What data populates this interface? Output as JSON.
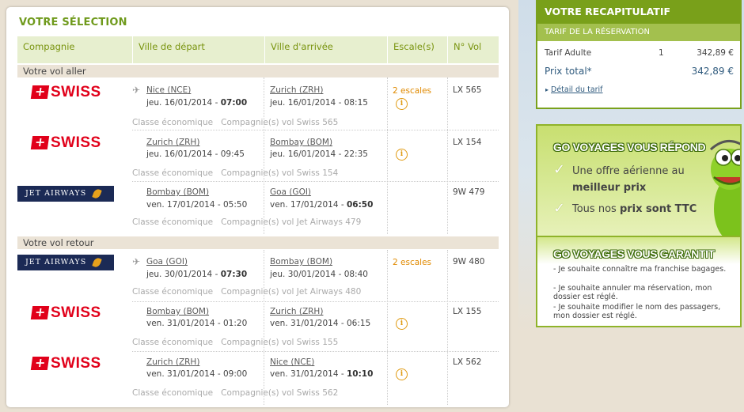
{
  "selection": {
    "title": "VOTRE SÉLECTION",
    "headers": [
      "Compagnie",
      "Ville de départ",
      "Ville d'arrivée",
      "Escale(s)",
      "N° Vol"
    ],
    "outbound_label": "Votre vol aller",
    "return_label": "Votre vol retour",
    "flights": [
      {
        "airline": "SWISS",
        "dep_city": "Nice (NCE)",
        "dep_date": "jeu. 16/01/2014 - ",
        "dep_time": "07:00",
        "arr_city": "Zurich (ZRH)",
        "arr_date": "jeu. 16/01/2014 - 08:15",
        "arr_time": "",
        "stops": "2 escales",
        "flight_no": "LX 565",
        "class": "Classe économique",
        "operated": "Compagnie(s) vol Swiss 565"
      },
      {
        "airline": "SWISS",
        "dep_city": "Zurich (ZRH)",
        "dep_date": "jeu. 16/01/2014 - 09:45",
        "dep_time": "",
        "arr_city": "Bombay (BOM)",
        "arr_date": "jeu. 16/01/2014 - 22:35",
        "arr_time": "",
        "stops": "",
        "flight_no": "LX 154",
        "class": "Classe économique",
        "operated": "Compagnie(s) vol Swiss 154"
      },
      {
        "airline": "JET AIRWAYS",
        "dep_city": "Bombay (BOM)",
        "dep_date": "ven. 17/01/2014 - 05:50",
        "dep_time": "",
        "arr_city": "Goa (GOI)",
        "arr_date": "ven. 17/01/2014 - ",
        "arr_time": "06:50",
        "stops": "",
        "flight_no": "9W 479",
        "class": "Classe économique",
        "operated": "Compagnie(s) vol Jet Airways 479"
      },
      {
        "airline": "JET AIRWAYS",
        "dep_city": "Goa (GOI)",
        "dep_date": "jeu. 30/01/2014 - ",
        "dep_time": "07:30",
        "arr_city": "Bombay (BOM)",
        "arr_date": "jeu. 30/01/2014 - 08:40",
        "arr_time": "",
        "stops": "2 escales",
        "flight_no": "9W 480",
        "class": "Classe économique",
        "operated": "Compagnie(s) vol Jet Airways 480"
      },
      {
        "airline": "SWISS",
        "dep_city": "Bombay (BOM)",
        "dep_date": "ven. 31/01/2014 - 01:20",
        "dep_time": "",
        "arr_city": "Zurich (ZRH)",
        "arr_date": "ven. 31/01/2014 - 06:15",
        "arr_time": "",
        "stops": "",
        "flight_no": "LX 155",
        "class": "Classe économique",
        "operated": "Compagnie(s) vol Swiss 155"
      },
      {
        "airline": "SWISS",
        "dep_city": "Zurich (ZRH)",
        "dep_date": "ven. 31/01/2014 - 09:00",
        "dep_time": "",
        "arr_city": "Nice (NCE)",
        "arr_date": "ven. 31/01/2014 - ",
        "arr_time": "10:10",
        "stops": "",
        "flight_no": "LX 562",
        "class": "Classe économique",
        "operated": "Compagnie(s) vol Swiss 562"
      }
    ]
  },
  "recap": {
    "title": "VOTRE RECAPITULATIF",
    "subtitle": "TARIF DE LA RÉSERVATION",
    "adult_label": "Tarif Adulte",
    "adult_qty": "1",
    "adult_price": "342,89 €",
    "total_label": "Prix total*",
    "total_price": "342,89 €",
    "detail_link": "Détail du tarif"
  },
  "promo": {
    "respond_title": "GO VOYAGES VOUS RÉPOND",
    "line1a": "Une offre aérienne au",
    "line1b": "meilleur prix",
    "line2a": "Tous nos ",
    "line2b": "prix sont TTC",
    "guarantee_title": "GO VOYAGES VOUS GARANTIT",
    "guarantees": [
      "- Je souhaite connaître ma franchise bagages.",
      "- Je souhaite annuler ma réservation, mon dossier est réglé.",
      "- Je souhaite modifier le nom des passagers, mon dossier est réglé."
    ]
  },
  "colors": {
    "green": "#79a01a",
    "orange": "#e08a00",
    "swiss_red": "#e1001a",
    "jet_navy": "#1b2a55"
  }
}
